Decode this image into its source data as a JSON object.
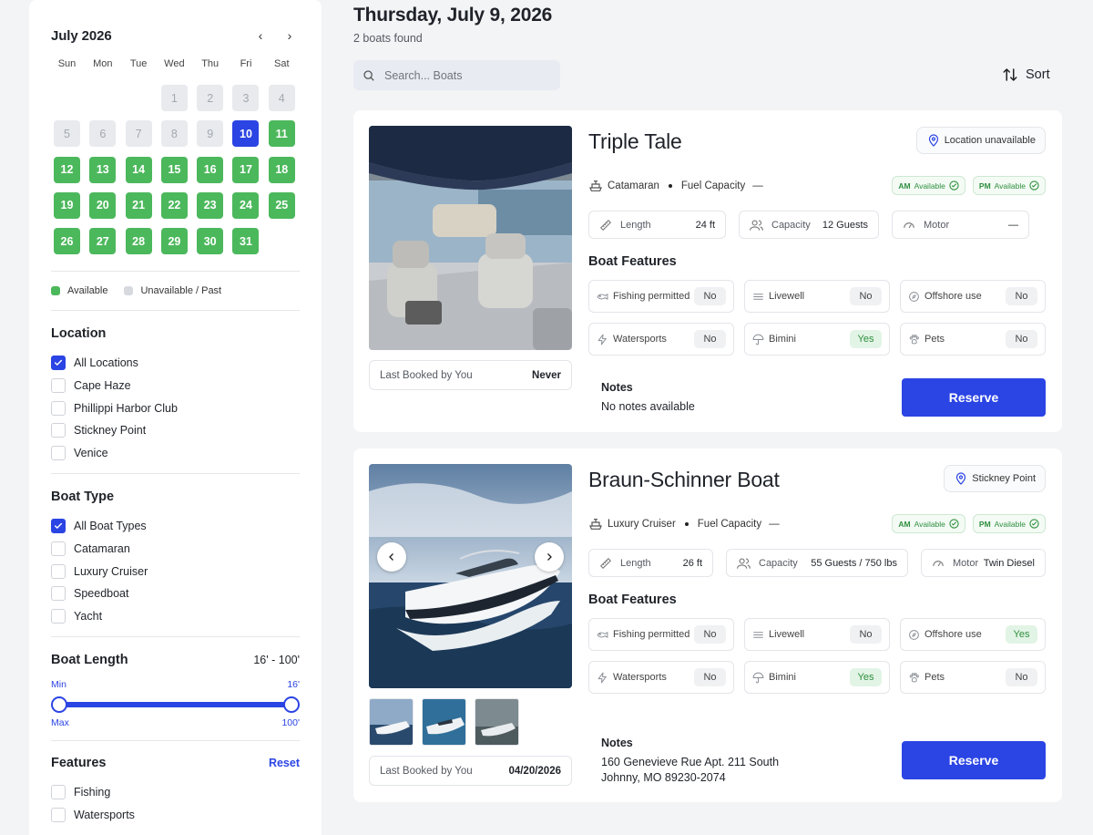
{
  "calendar": {
    "month_label": "July 2026",
    "prev_icon": "‹",
    "next_icon": "›",
    "weekdays": [
      "Sun",
      "Mon",
      "Tue",
      "Wed",
      "Thu",
      "Fri",
      "Sat"
    ],
    "days": [
      {
        "d": "",
        "s": "empty"
      },
      {
        "d": "",
        "s": "empty"
      },
      {
        "d": "",
        "s": "empty"
      },
      {
        "d": "1",
        "s": "past"
      },
      {
        "d": "2",
        "s": "past"
      },
      {
        "d": "3",
        "s": "past"
      },
      {
        "d": "4",
        "s": "past"
      },
      {
        "d": "5",
        "s": "past"
      },
      {
        "d": "6",
        "s": "past"
      },
      {
        "d": "7",
        "s": "past"
      },
      {
        "d": "8",
        "s": "past"
      },
      {
        "d": "9",
        "s": "past"
      },
      {
        "d": "10",
        "s": "sel"
      },
      {
        "d": "11",
        "s": "avail"
      },
      {
        "d": "12",
        "s": "avail"
      },
      {
        "d": "13",
        "s": "avail"
      },
      {
        "d": "14",
        "s": "avail"
      },
      {
        "d": "15",
        "s": "avail"
      },
      {
        "d": "16",
        "s": "avail"
      },
      {
        "d": "17",
        "s": "avail"
      },
      {
        "d": "18",
        "s": "avail"
      },
      {
        "d": "19",
        "s": "avail"
      },
      {
        "d": "20",
        "s": "avail"
      },
      {
        "d": "21",
        "s": "avail"
      },
      {
        "d": "22",
        "s": "avail"
      },
      {
        "d": "23",
        "s": "avail"
      },
      {
        "d": "24",
        "s": "avail"
      },
      {
        "d": "25",
        "s": "avail"
      },
      {
        "d": "26",
        "s": "avail"
      },
      {
        "d": "27",
        "s": "avail"
      },
      {
        "d": "28",
        "s": "avail"
      },
      {
        "d": "29",
        "s": "avail"
      },
      {
        "d": "30",
        "s": "avail"
      },
      {
        "d": "31",
        "s": "avail"
      }
    ],
    "legend_available": "Available",
    "legend_unavailable": "Unavailable / Past"
  },
  "colors": {
    "accent": "#2b44e4",
    "available": "#4cb85c",
    "unavailable": "#d6d9de"
  },
  "filters": {
    "location": {
      "title": "Location",
      "options": [
        {
          "label": "All Locations",
          "checked": true
        },
        {
          "label": "Cape Haze",
          "checked": false
        },
        {
          "label": "Phillippi Harbor Club",
          "checked": false
        },
        {
          "label": "Stickney Point",
          "checked": false
        },
        {
          "label": "Venice",
          "checked": false
        }
      ]
    },
    "boat_type": {
      "title": "Boat Type",
      "options": [
        {
          "label": "All Boat Types",
          "checked": true
        },
        {
          "label": "Catamaran",
          "checked": false
        },
        {
          "label": "Luxury Cruiser",
          "checked": false
        },
        {
          "label": "Speedboat",
          "checked": false
        },
        {
          "label": "Yacht",
          "checked": false
        }
      ]
    },
    "boat_length": {
      "title": "Boat Length",
      "range_text": "16' - 100'",
      "min_label": "Min",
      "min_value": "16'",
      "max_label": "Max",
      "max_value": "100'"
    },
    "features": {
      "title": "Features",
      "reset_label": "Reset",
      "options": [
        {
          "label": "Fishing",
          "checked": false
        },
        {
          "label": "Watersports",
          "checked": false
        }
      ]
    }
  },
  "header": {
    "date_title": "Thursday, July 9, 2026",
    "count_text": "2 boats found",
    "search_placeholder": "Search... Boats",
    "sort_label": "Sort"
  },
  "boats": [
    {
      "name": "Triple Tale",
      "location": "Location unavailable",
      "type": "Catamaran",
      "fuel_label": "Fuel Capacity",
      "fuel_value": "—",
      "am_label": "AM",
      "am_status": "Available",
      "pm_label": "PM",
      "pm_status": "Available",
      "length_label": "Length",
      "length_value": "24 ft",
      "capacity_label": "Capacity",
      "capacity_value": "12 Guests",
      "motor_label": "Motor",
      "motor_value": "—",
      "features_title": "Boat Features",
      "features": [
        {
          "label": "Fishing permitted",
          "value": "No",
          "icon": "fish-icon"
        },
        {
          "label": "Livewell",
          "value": "No",
          "icon": "water-icon"
        },
        {
          "label": "Offshore use",
          "value": "No",
          "icon": "compass-icon"
        },
        {
          "label": "Watersports",
          "value": "No",
          "icon": "bolt-icon"
        },
        {
          "label": "Bimini",
          "value": "Yes",
          "icon": "umbrella-icon"
        },
        {
          "label": "Pets",
          "value": "No",
          "icon": "paw-icon"
        }
      ],
      "last_booked_label": "Last Booked by You",
      "last_booked_value": "Never",
      "notes_title": "Notes",
      "notes_lines": [
        "No notes available"
      ],
      "reserve_label": "Reserve"
    },
    {
      "name": "Braun-Schinner Boat",
      "location": "Stickney Point",
      "type": "Luxury Cruiser",
      "fuel_label": "Fuel Capacity",
      "fuel_value": "—",
      "am_label": "AM",
      "am_status": "Available",
      "pm_label": "PM",
      "pm_status": "Available",
      "length_label": "Length",
      "length_value": "26 ft",
      "capacity_label": "Capacity",
      "capacity_value": "55 Guests / 750 lbs",
      "motor_label": "Motor",
      "motor_value": "Twin Diesel",
      "features_title": "Boat Features",
      "features": [
        {
          "label": "Fishing permitted",
          "value": "No",
          "icon": "fish-icon"
        },
        {
          "label": "Livewell",
          "value": "No",
          "icon": "water-icon"
        },
        {
          "label": "Offshore use",
          "value": "Yes",
          "icon": "compass-icon"
        },
        {
          "label": "Watersports",
          "value": "No",
          "icon": "bolt-icon"
        },
        {
          "label": "Bimini",
          "value": "Yes",
          "icon": "umbrella-icon"
        },
        {
          "label": "Pets",
          "value": "No",
          "icon": "paw-icon"
        }
      ],
      "last_booked_label": "Last Booked by You",
      "last_booked_value": "04/20/2026",
      "notes_title": "Notes",
      "notes_lines": [
        "160 Genevieve Rue Apt. 211 South",
        "Johnny, MO 89230-2074"
      ],
      "reserve_label": "Reserve"
    }
  ]
}
